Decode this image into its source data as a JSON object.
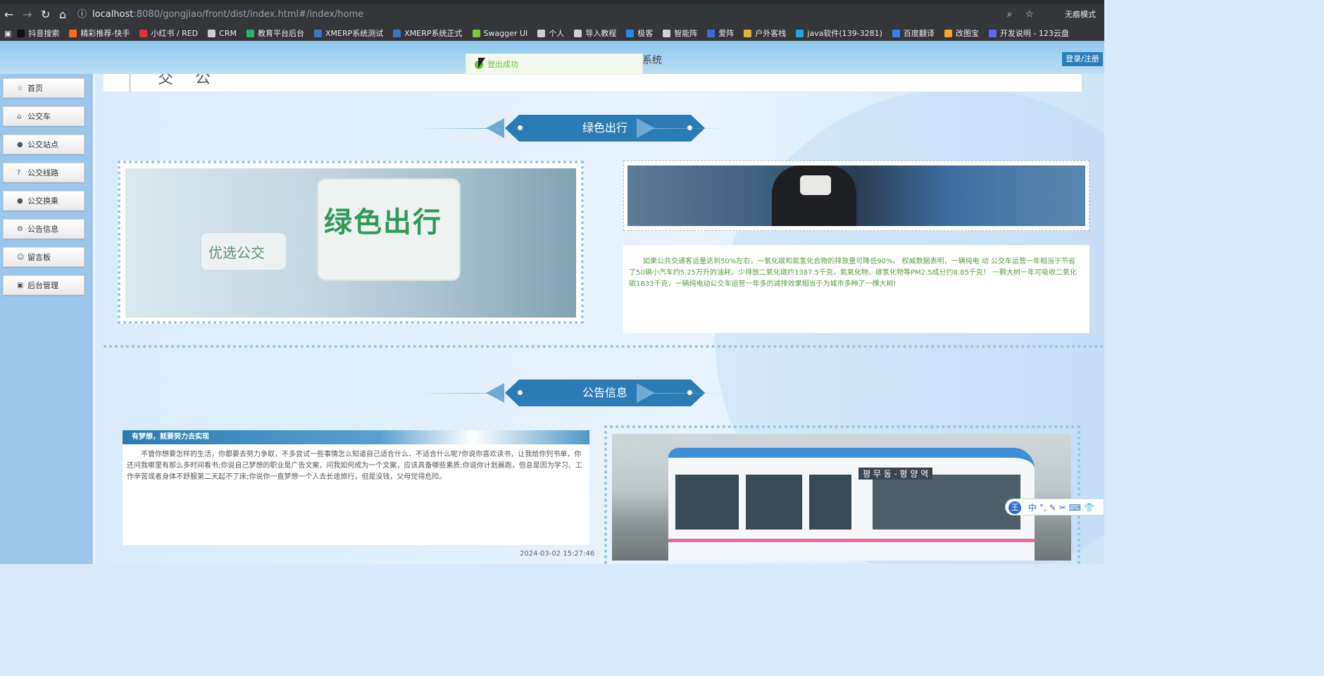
{
  "browser": {
    "url_host": "localhost",
    "url_path": ":8080/gongjiao/front/dist/index.html#/index/home",
    "mode_label": "无痕模式",
    "bookmarks": [
      {
        "label": "抖音搜索",
        "color": "#111111"
      },
      {
        "label": "精彩推荐-快手",
        "color": "#ff6a20"
      },
      {
        "label": "小红书 / RED",
        "color": "#e62e3c"
      },
      {
        "label": "CRM",
        "color": "#cfcfcf"
      },
      {
        "label": "教育平台后台",
        "color": "#2fb36b"
      },
      {
        "label": "XMERP系统测试",
        "color": "#3c76c4"
      },
      {
        "label": "XMERP系统正式",
        "color": "#3c76c4"
      },
      {
        "label": "Swagger UI",
        "color": "#85c53a"
      },
      {
        "label": "个人",
        "color": "#cfcfcf"
      },
      {
        "label": "导入教程",
        "color": "#cfcfcf"
      },
      {
        "label": "极客",
        "color": "#2a8ae4"
      },
      {
        "label": "智能阵",
        "color": "#cfcfcf"
      },
      {
        "label": "爱阵",
        "color": "#3a6de0"
      },
      {
        "label": "户外客栈",
        "color": "#e3b23c"
      },
      {
        "label": "java软件(139-3281)",
        "color": "#21a7d8"
      },
      {
        "label": "百度翻译",
        "color": "#3b7ef5"
      },
      {
        "label": "改图宝",
        "color": "#f5a623"
      },
      {
        "label": "开发说明 - 123云盘",
        "color": "#5b6cf0"
      }
    ]
  },
  "header": {
    "title_partial": "系统",
    "login_label": "登录/注册"
  },
  "toast": {
    "message": "登出成功"
  },
  "sidebar": {
    "items": [
      {
        "label": "首页",
        "icon": "☆"
      },
      {
        "label": "公交车",
        "icon": "⌂"
      },
      {
        "label": "公交站点",
        "icon": "●"
      },
      {
        "label": "公交线路",
        "icon": "?"
      },
      {
        "label": "公交换乘",
        "icon": "●"
      },
      {
        "label": "公告信息",
        "icon": "⚙"
      },
      {
        "label": "留言板",
        "icon": "☺"
      },
      {
        "label": "后台管理",
        "icon": "▣"
      }
    ]
  },
  "prev_section": {
    "partial_title": "交 公"
  },
  "green_section": {
    "title": "绿色出行",
    "image_sign_text": "绿色出行",
    "image_small_sign_text": "优选公交",
    "description": "如果公共交通客运量达到50%左右，一氧化碳和氮氢化合物的排放量可降低90%。 权威数据表明，一辆纯电 动 公交车运营一年相当于节省了50辆小汽车约5.25万升的油耗，少排放二氧化碳约1387.5千克，氮氧化物、碳氢化物等PM2.5成分约8.85千克！ 一颗大树一年可吸收二氧化碳1833千克，一辆纯电动公交车运营一年多的减排效果相当于为城市多种了一棵大树!"
  },
  "notice_section": {
    "title": "公告信息",
    "card_title": "有梦想，就要努力去实现",
    "card_body": "不管你想要怎样的生活，你都要去努力争取，不多尝试一些事情怎么知道自己适合什么、不适合什么呢?你说你喜欢读书，让我给你列书单，你还问我哪里有那么多时间看书;你说自己梦想的职业是广告文案，问我如何成为一个文案，应该具备哪些素质;你说你计划晨跑，但总是因为学习、工作辛苦或者身体不舒服第二天起不了床;你说你一直梦想一个人去长途旅行，但是没钱，父母觉得危险。",
    "card_time": "2024-03-02 15:27:46",
    "bus_sign_text": "평 무 동 - 평 양 역"
  },
  "ime": {
    "items": [
      "中",
      "°,",
      "✎",
      "✂",
      "⌨",
      "👕"
    ]
  }
}
